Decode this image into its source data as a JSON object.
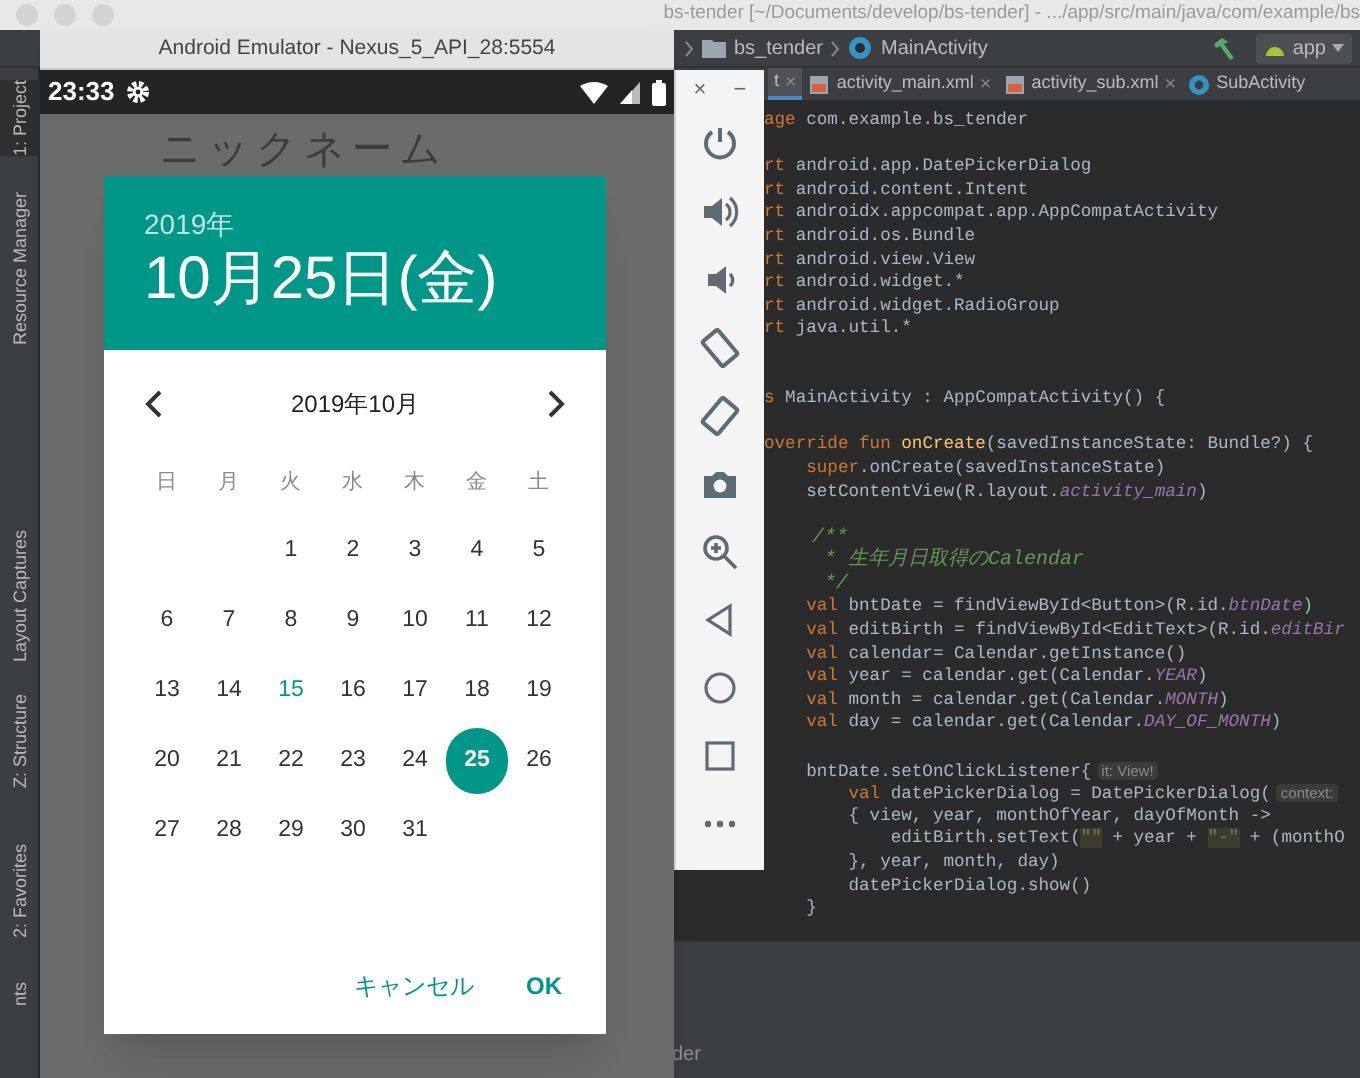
{
  "ide": {
    "title": "bs-tender [~/Documents/develop/bs-tender] - .../app/src/main/java/com/example/bs",
    "breadcrumbs": [
      "bs_tender",
      "MainActivity"
    ],
    "run_config": "app",
    "tabs": [
      {
        "label": "t",
        "close": "×",
        "selected": true
      },
      {
        "label": "activity_main.xml",
        "close": "×",
        "selected": false
      },
      {
        "label": "activity_sub.xml",
        "close": "×",
        "selected": false
      },
      {
        "label": "SubActivity",
        "selected": false
      }
    ],
    "tool_windows": [
      {
        "label": "1: Project",
        "selected": true
      },
      {
        "label": "Resource Manager",
        "selected": false
      },
      {
        "label": "Layout Captures",
        "selected": false
      },
      {
        "label": "Z: Structure",
        "selected": false
      },
      {
        "label": "2: Favorites",
        "selected": false
      },
      {
        "label": "nts",
        "selected": false
      }
    ],
    "code": [
      {
        "kind": "code",
        "segments": [
          {
            "kind": "keyword",
            "text": "age"
          },
          {
            "kind": "plain",
            "text": " com.example.bs_tender"
          }
        ]
      },
      {
        "kind": "blank"
      },
      {
        "kind": "code",
        "segments": [
          {
            "kind": "keyword",
            "text": "rt"
          },
          {
            "kind": "plain",
            "text": " android.app.DatePickerDialog"
          }
        ]
      },
      {
        "kind": "code",
        "segments": [
          {
            "kind": "keyword",
            "text": "rt"
          },
          {
            "kind": "plain",
            "text": " android.content.Intent"
          }
        ]
      },
      {
        "kind": "code",
        "segments": [
          {
            "kind": "keyword",
            "text": "rt"
          },
          {
            "kind": "plain",
            "text": " androidx.appcompat.app.AppCompatActivity"
          }
        ]
      },
      {
        "kind": "code",
        "segments": [
          {
            "kind": "keyword",
            "text": "rt"
          },
          {
            "kind": "plain",
            "text": " android.os.Bundle"
          }
        ]
      },
      {
        "kind": "code",
        "segments": [
          {
            "kind": "keyword",
            "text": "rt"
          },
          {
            "kind": "plain",
            "text": " android.view.View"
          }
        ]
      },
      {
        "kind": "code",
        "segments": [
          {
            "kind": "keyword",
            "text": "rt"
          },
          {
            "kind": "plain",
            "text": " android.widget.*"
          }
        ]
      },
      {
        "kind": "code",
        "segments": [
          {
            "kind": "keyword",
            "text": "rt"
          },
          {
            "kind": "plain",
            "text": " android.widget.RadioGroup"
          }
        ]
      },
      {
        "kind": "code",
        "segments": [
          {
            "kind": "keyword",
            "text": "rt"
          },
          {
            "kind": "plain",
            "text": " java.util.*"
          }
        ]
      },
      {
        "kind": "blank"
      },
      {
        "kind": "blank"
      },
      {
        "kind": "code",
        "segments": [
          {
            "kind": "keyword",
            "text": "s"
          },
          {
            "kind": "plain",
            "text": " MainActivity : AppCompatActivity() {"
          }
        ]
      },
      {
        "kind": "blank"
      },
      {
        "kind": "code",
        "segments": [
          {
            "kind": "keyword",
            "text": "override fun "
          },
          {
            "kind": "function",
            "text": "onCreate"
          },
          {
            "kind": "plain",
            "text": "(savedInstanceState: Bundle?) {"
          }
        ]
      },
      {
        "kind": "code",
        "segments": [
          {
            "kind": "keyword",
            "text": "    super"
          },
          {
            "kind": "plain",
            "text": ".onCreate(savedInstanceState)"
          }
        ]
      },
      {
        "kind": "code",
        "segments": [
          {
            "kind": "plain",
            "text": "    setContentView(R.layout."
          },
          {
            "kind": "constant",
            "text": "activity_main"
          },
          {
            "kind": "plain",
            "text": ")"
          }
        ]
      },
      {
        "kind": "blank"
      },
      {
        "kind": "code",
        "segments": [
          {
            "kind": "comment",
            "text": "    /**"
          }
        ]
      },
      {
        "kind": "code",
        "segments": [
          {
            "kind": "comment",
            "text": "     * 生年月日取得のCalendar"
          }
        ]
      },
      {
        "kind": "code",
        "segments": [
          {
            "kind": "comment",
            "text": "     */"
          }
        ]
      },
      {
        "kind": "code",
        "segments": [
          {
            "kind": "keyword",
            "text": "    val"
          },
          {
            "kind": "plain",
            "text": " bntDate = findViewById<Button>(R.id."
          },
          {
            "kind": "constant",
            "text": "btnDate"
          },
          {
            "kind": "plain",
            "text": ")"
          }
        ]
      },
      {
        "kind": "code",
        "segments": [
          {
            "kind": "keyword",
            "text": "    val"
          },
          {
            "kind": "plain",
            "text": " editBirth = findViewById<EditText>(R.id."
          },
          {
            "kind": "constant",
            "text": "editBir"
          }
        ]
      },
      {
        "kind": "code",
        "segments": [
          {
            "kind": "keyword",
            "text": "    val"
          },
          {
            "kind": "plain",
            "text": " calendar= Calendar.getInstance()"
          }
        ]
      },
      {
        "kind": "code",
        "segments": [
          {
            "kind": "keyword",
            "text": "    val"
          },
          {
            "kind": "plain",
            "text": " year = calendar.get(Calendar."
          },
          {
            "kind": "constant",
            "text": "YEAR"
          },
          {
            "kind": "plain",
            "text": ")"
          }
        ]
      },
      {
        "kind": "code",
        "segments": [
          {
            "kind": "keyword",
            "text": "    val"
          },
          {
            "kind": "plain",
            "text": " month = calendar.get(Calendar."
          },
          {
            "kind": "constant",
            "text": "MONTH"
          },
          {
            "kind": "plain",
            "text": ")"
          }
        ]
      },
      {
        "kind": "code",
        "segments": [
          {
            "kind": "keyword",
            "text": "    val"
          },
          {
            "kind": "plain",
            "text": " day = calendar.get(Calendar."
          },
          {
            "kind": "constant",
            "text": "DAY_OF_MONTH"
          },
          {
            "kind": "plain",
            "text": ")"
          }
        ]
      },
      {
        "kind": "blank"
      },
      {
        "kind": "code",
        "segments": [
          {
            "kind": "plain",
            "text": "    bntDate.setOnClickListener{"
          },
          {
            "kind": "hint",
            "text": "it: View!"
          }
        ]
      },
      {
        "kind": "code",
        "segments": [
          {
            "kind": "keyword",
            "text": "        val"
          },
          {
            "kind": "plain",
            "text": " datePickerDialog = DatePickerDialog("
          },
          {
            "kind": "hint",
            "text": "context:"
          }
        ]
      },
      {
        "kind": "code",
        "segments": [
          {
            "kind": "plain",
            "text": "        { view, year, monthOfYear, dayOfMonth ->"
          }
        ]
      },
      {
        "kind": "code",
        "segments": [
          {
            "kind": "plain",
            "text": "            editBirth.setText("
          },
          {
            "kind": "string",
            "text": "\"\""
          },
          {
            "kind": "plain",
            "text": " + year + "
          },
          {
            "kind": "string",
            "text": "\"-\""
          },
          {
            "kind": "plain",
            "text": " + (monthO"
          }
        ]
      },
      {
        "kind": "code",
        "segments": [
          {
            "kind": "plain",
            "text": "        }, year, month, day)"
          }
        ]
      },
      {
        "kind": "code",
        "segments": [
          {
            "kind": "plain",
            "text": "        datePickerDialog.show()"
          }
        ]
      },
      {
        "kind": "code",
        "segments": [
          {
            "kind": "plain",
            "text": "    }"
          }
        ]
      }
    ],
    "bottom_text": "der"
  },
  "emulator": {
    "title": "Android Emulator - Nexus_5_API_28:5554",
    "time": "23:33",
    "app_label": "ニックネーム",
    "window_controls": [
      "×",
      "−"
    ],
    "dialog": {
      "year": "2019年",
      "date": "10月25日(金)",
      "month": "2019年10月",
      "weekdays": [
        "日",
        "月",
        "火",
        "水",
        "木",
        "金",
        "土"
      ],
      "weeks": [
        [
          {
            "label": "1",
            "today": false,
            "selected": false
          },
          {
            "label": "2",
            "today": false,
            "selected": false
          },
          {
            "label": "3",
            "today": false,
            "selected": false
          },
          {
            "label": "4",
            "today": false,
            "selected": false
          },
          {
            "label": "5",
            "today": false,
            "selected": false
          }
        ],
        [
          {
            "label": "6",
            "today": false,
            "selected": false
          },
          {
            "label": "7",
            "today": false,
            "selected": false
          },
          {
            "label": "8",
            "today": false,
            "selected": false
          },
          {
            "label": "9",
            "today": false,
            "selected": false
          },
          {
            "label": "10",
            "today": false,
            "selected": false
          },
          {
            "label": "11",
            "today": false,
            "selected": false
          },
          {
            "label": "12",
            "today": false,
            "selected": false
          }
        ],
        [
          {
            "label": "13",
            "today": false,
            "selected": false
          },
          {
            "label": "14",
            "today": false,
            "selected": false
          },
          {
            "label": "15",
            "today": true,
            "selected": false
          },
          {
            "label": "16",
            "today": false,
            "selected": false
          },
          {
            "label": "17",
            "today": false,
            "selected": false
          },
          {
            "label": "18",
            "today": false,
            "selected": false
          },
          {
            "label": "19",
            "today": false,
            "selected": false
          }
        ],
        [
          {
            "label": "20",
            "today": false,
            "selected": false
          },
          {
            "label": "21",
            "today": false,
            "selected": false
          },
          {
            "label": "22",
            "today": false,
            "selected": false
          },
          {
            "label": "23",
            "today": false,
            "selected": false
          },
          {
            "label": "24",
            "today": false,
            "selected": false
          },
          {
            "label": "25",
            "today": false,
            "selected": true
          },
          {
            "label": "26",
            "today": false,
            "selected": false
          }
        ],
        [
          {
            "label": "27",
            "today": false,
            "selected": false
          },
          {
            "label": "28",
            "today": false,
            "selected": false
          },
          {
            "label": "29",
            "today": false,
            "selected": false
          },
          {
            "label": "30",
            "today": false,
            "selected": false
          },
          {
            "label": "31",
            "today": false,
            "selected": false
          }
        ]
      ],
      "buttons": [
        "キャンセル",
        "OK"
      ]
    }
  }
}
